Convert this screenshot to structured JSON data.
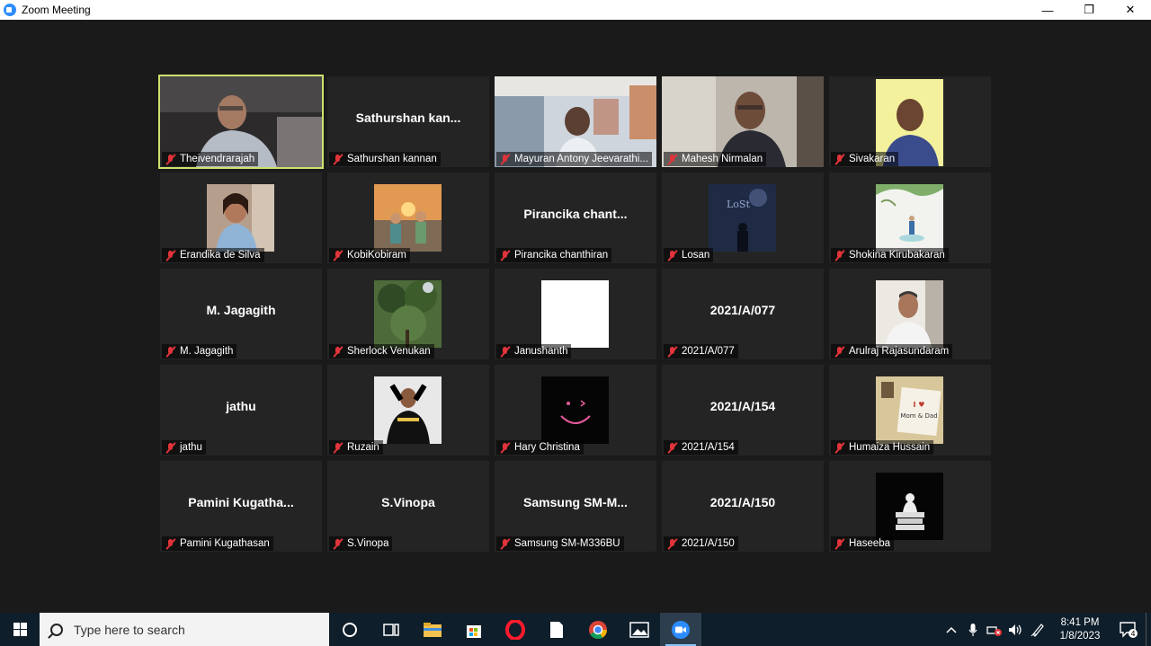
{
  "window": {
    "title": "Zoom Meeting",
    "minimize": "—",
    "restore": "❐",
    "close": "✕"
  },
  "participants": [
    {
      "name": "Theivendrarajah",
      "big": "",
      "kind": "video1",
      "active": true
    },
    {
      "name": "Sathurshan kannan",
      "big": "Sathurshan  kan...",
      "kind": "text"
    },
    {
      "name": "Mayuran Antony Jeevarathi...",
      "big": "",
      "kind": "video2"
    },
    {
      "name": "Mahesh Nirmalan",
      "big": "",
      "kind": "video3"
    },
    {
      "name": "Sivakaran",
      "big": "",
      "kind": "avatar-man"
    },
    {
      "name": "Erandika de Silva",
      "big": "",
      "kind": "avatar-girl"
    },
    {
      "name": "KobiKobiram",
      "big": "",
      "kind": "avatar-kids"
    },
    {
      "name": "Pirancika chanthiran",
      "big": "Pirancika  chant...",
      "kind": "text"
    },
    {
      "name": "Losan",
      "big": "",
      "kind": "avatar-lost"
    },
    {
      "name": "Shokina Kirubakaran",
      "big": "",
      "kind": "avatar-art"
    },
    {
      "name": "M. Jagagith",
      "big": "M. Jagagith",
      "kind": "text"
    },
    {
      "name": "Sherlock Venukan",
      "big": "",
      "kind": "avatar-tree"
    },
    {
      "name": "Janushanth",
      "big": "",
      "kind": "avatar-white"
    },
    {
      "name": "2021/A/077",
      "big": "2021/A/077",
      "kind": "text"
    },
    {
      "name": "Arulraj Rajasundaram",
      "big": "",
      "kind": "avatar-smile"
    },
    {
      "name": "jathu",
      "big": "jathu",
      "kind": "text"
    },
    {
      "name": "Ruzain",
      "big": "",
      "kind": "avatar-pose"
    },
    {
      "name": "Hary Christina",
      "big": "",
      "kind": "avatar-smiley"
    },
    {
      "name": "2021/A/154",
      "big": "2021/A/154",
      "kind": "text"
    },
    {
      "name": "Humaiza Hussain",
      "big": "",
      "kind": "avatar-note"
    },
    {
      "name": "Pamini Kugathasan",
      "big": "Pamini  Kugatha...",
      "kind": "text"
    },
    {
      "name": "S.Vinopa",
      "big": "S.Vinopa",
      "kind": "text"
    },
    {
      "name": "Samsung SM-M336BU",
      "big": "Samsung  SM-M...",
      "kind": "text"
    },
    {
      "name": "2021/A/150",
      "big": "2021/A/150",
      "kind": "text"
    },
    {
      "name": "Haseeba",
      "big": "",
      "kind": "avatar-books"
    }
  ],
  "avatar_text": {
    "lost": "LoSt",
    "note_top": "I ♥",
    "note_mid": "Mom & Dad"
  },
  "taskbar": {
    "search_placeholder": "Type here to search",
    "time": "8:41 PM",
    "date": "1/8/2023",
    "notifications": "4"
  },
  "colors": {
    "active_speaker": "#cde26a",
    "muted_mic": "#e0343a",
    "zoom_blue": "#2d8cff"
  }
}
